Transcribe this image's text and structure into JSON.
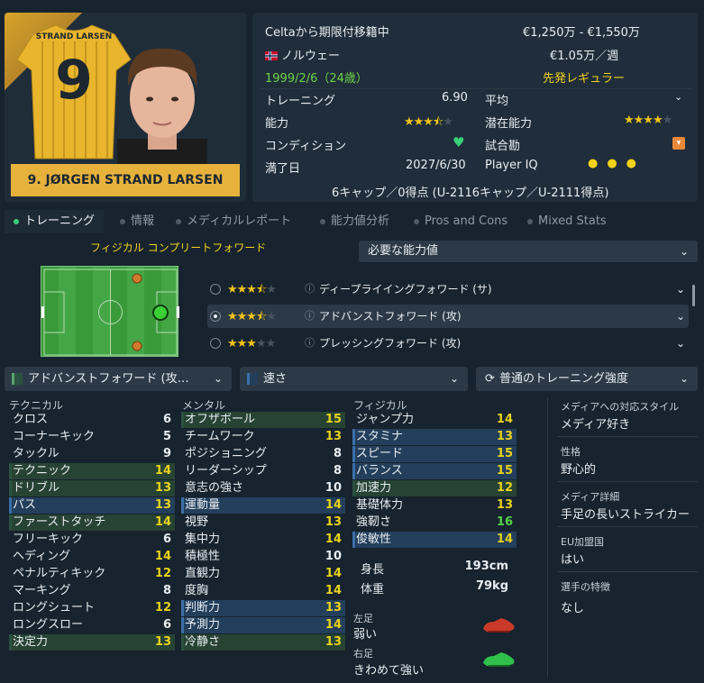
{
  "player": {
    "shirt_name": "STRAND LARSEN",
    "shirt_number": "9",
    "name_plate": "9. JØRGEN STRAND LARSEN"
  },
  "info": {
    "status": "Celtaから期限付移籍中",
    "value": "€1,250万 - €1,550万",
    "nationality": "ノルウェー",
    "wage": "€1.05万／週",
    "birth": "1999/2/6（24歳）",
    "squad_status": "先発レギュラー",
    "training_label": "トレーニング",
    "training_value": "6.90",
    "average_label": "平均",
    "ability_label": "能力",
    "ability_stars": 3.5,
    "potential_label": "潜在能力",
    "potential_stars": 4,
    "condition_label": "コンディション",
    "match_label": "試合勘",
    "expiry_label": "満了日",
    "expiry_value": "2027/6/30",
    "iq_label": "Player IQ",
    "iq_dots": 3,
    "caps": "6キャップ／0得点 (U-2116キャップ／U-2111得点)",
    "colors": {
      "norway_red": "#c8102e",
      "condition_heart": "#3ad07a",
      "match_icon": "#e8893a"
    }
  },
  "tabs": [
    {
      "label": "トレーニング",
      "active": true
    },
    {
      "label": "情報",
      "active": false
    },
    {
      "label": "メディカルレポート",
      "active": false
    },
    {
      "label": "能力値分析",
      "active": false
    },
    {
      "label": "Pros and Cons",
      "active": false
    },
    {
      "label": "Mixed Stats",
      "active": false
    }
  ],
  "role": {
    "title": "フィジカル コンプリートフォワード",
    "required_dropdown": "必要な能力値",
    "options": [
      {
        "stars": 3.5,
        "name": "ディープライイングフォワード (サ)",
        "selected": false
      },
      {
        "stars": 3.5,
        "name": "アドバンストフォワード (攻)",
        "selected": true
      },
      {
        "stars": 3,
        "name": "プレッシングフォワード (攻)",
        "selected": false
      }
    ]
  },
  "dropdowns": {
    "role": "アドバンストフォワード (攻…",
    "focus": "速さ",
    "intensity": "普通のトレーニング強度"
  },
  "attributes": {
    "technical_head": "テクニカル",
    "mental_head": "メンタル",
    "physical_head": "フィジカル",
    "technical": [
      {
        "label": "クロス",
        "value": 6,
        "hl": ""
      },
      {
        "label": "コーナーキック",
        "value": 5,
        "hl": ""
      },
      {
        "label": "タックル",
        "value": 9,
        "hl": ""
      },
      {
        "label": "テクニック",
        "value": 14,
        "hl": "green"
      },
      {
        "label": "ドリブル",
        "value": 13,
        "hl": "green"
      },
      {
        "label": "パス",
        "value": 13,
        "hl": "blue"
      },
      {
        "label": "ファーストタッチ",
        "value": 14,
        "hl": "green"
      },
      {
        "label": "フリーキック",
        "value": 6,
        "hl": ""
      },
      {
        "label": "ヘディング",
        "value": 14,
        "hl": ""
      },
      {
        "label": "ペナルティキック",
        "value": 12,
        "hl": ""
      },
      {
        "label": "マーキング",
        "value": 8,
        "hl": ""
      },
      {
        "label": "ロングシュート",
        "value": 12,
        "hl": ""
      },
      {
        "label": "ロングスロー",
        "value": 6,
        "hl": ""
      },
      {
        "label": "決定力",
        "value": 13,
        "hl": "green"
      }
    ],
    "mental": [
      {
        "label": "オフザボール",
        "value": 15,
        "hl": "green"
      },
      {
        "label": "チームワーク",
        "value": 13,
        "hl": ""
      },
      {
        "label": "ポジショニング",
        "value": 8,
        "hl": ""
      },
      {
        "label": "リーダーシップ",
        "value": 8,
        "hl": ""
      },
      {
        "label": "意志の強さ",
        "value": 10,
        "hl": ""
      },
      {
        "label": "運動量",
        "value": 14,
        "hl": "blue"
      },
      {
        "label": "視野",
        "value": 13,
        "hl": ""
      },
      {
        "label": "集中力",
        "value": 14,
        "hl": ""
      },
      {
        "label": "積極性",
        "value": 10,
        "hl": ""
      },
      {
        "label": "直観力",
        "value": 14,
        "hl": ""
      },
      {
        "label": "度胸",
        "value": 14,
        "hl": ""
      },
      {
        "label": "判断力",
        "value": 13,
        "hl": "blue"
      },
      {
        "label": "予測力",
        "value": 14,
        "hl": "blue"
      },
      {
        "label": "冷静さ",
        "value": 13,
        "hl": "green"
      }
    ],
    "physical": [
      {
        "label": "ジャンプ力",
        "value": 14,
        "hl": ""
      },
      {
        "label": "スタミナ",
        "value": 13,
        "hl": "blue"
      },
      {
        "label": "スピード",
        "value": 15,
        "hl": "blue"
      },
      {
        "label": "バランス",
        "value": 15,
        "hl": "blue"
      },
      {
        "label": "加速力",
        "value": 12,
        "hl": "green"
      },
      {
        "label": "基礎体力",
        "value": 13,
        "hl": ""
      },
      {
        "label": "強靭さ",
        "value": 16,
        "hl": ""
      },
      {
        "label": "俊敏性",
        "value": 14,
        "hl": "blue"
      }
    ],
    "height_label": "身長",
    "height_value": "193cm",
    "weight_label": "体重",
    "weight_value": "79kg",
    "left_foot_label": "左足",
    "left_foot_value": "弱い",
    "right_foot_label": "右足",
    "right_foot_value": "きわめて強い"
  },
  "side": {
    "media_label": "メディアへの対応スタイル",
    "media_value": "メディア好き",
    "personality_label": "性格",
    "personality_value": "野心的",
    "media_desc_label": "メディア詳細",
    "media_desc_value": "手足の長いストライカー",
    "eu_label": "EU加盟国",
    "eu_value": "はい",
    "traits_label": "選手の特徴",
    "traits_value": "なし"
  }
}
